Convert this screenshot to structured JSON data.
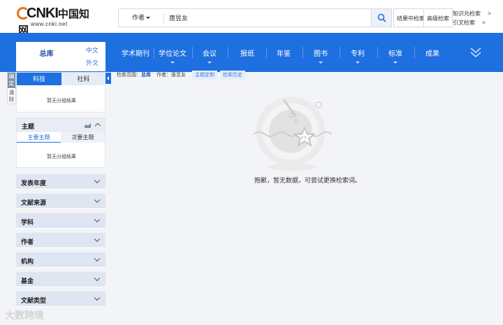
{
  "logo": {
    "mark": "CNKI",
    "chinese": "中国知网",
    "url": "www.cnki.net"
  },
  "search": {
    "field": "作者",
    "value": "唐昱友",
    "button": "search-icon"
  },
  "header_buttons": {
    "in_results": "结果中检索",
    "advanced": "高级检索"
  },
  "header_links": {
    "knowledge": "知识元检索",
    "citation": "引文检索",
    "arrow": ">"
  },
  "nav": {
    "items": [
      {
        "label": "学术期刊",
        "dropdown": false
      },
      {
        "label": "学位论文",
        "dropdown": true
      },
      {
        "label": "会议",
        "dropdown": true
      },
      {
        "label": "报纸",
        "dropdown": false
      },
      {
        "label": "年鉴",
        "dropdown": false
      },
      {
        "label": "图书",
        "dropdown": true
      },
      {
        "label": "专利",
        "dropdown": true
      },
      {
        "label": "标准",
        "dropdown": true
      },
      {
        "label": "成果",
        "dropdown": false
      }
    ]
  },
  "library": {
    "name": "总库",
    "lang_cn": "中文",
    "lang_foreign": "外文"
  },
  "side_handle": {
    "top": "确定",
    "bottom": "清除"
  },
  "category_tabs": {
    "tab1": "科技",
    "tab2": "社科",
    "empty": "暂无分组结果"
  },
  "topic": {
    "title": "主题",
    "sub1": "主要主题",
    "sub2": "次要主题",
    "empty": "暂无分组结果"
  },
  "facets": [
    "发表年度",
    "文献来源",
    "学科",
    "作者",
    "机构",
    "基金",
    "文献类型"
  ],
  "crumb": {
    "scope_label": "检索范围：",
    "scope_value": "总库",
    "author_label": "作者：",
    "author_value": "唐昱友"
  },
  "chips": {
    "custom": "主题定制",
    "history": "检索历史"
  },
  "empty_message": "抱歉，暂无数据，可尝试更换检索词。",
  "watermark": "大数跨境",
  "colors": {
    "nav_blue": "#1e6fe0",
    "facet_bg": "#dfe6f2",
    "link_blue": "#3778d6"
  }
}
